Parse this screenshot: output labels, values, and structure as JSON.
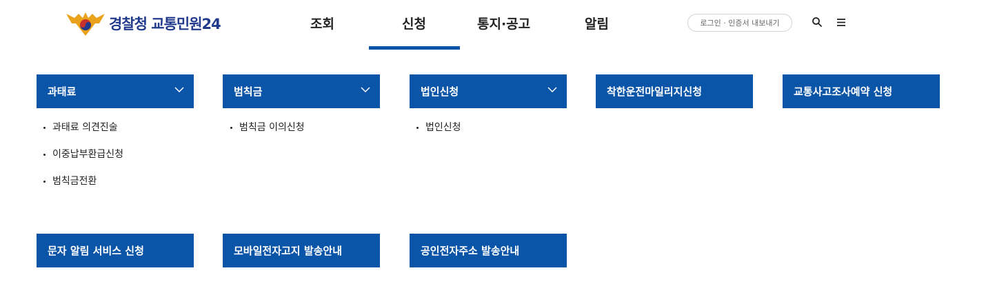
{
  "brand": {
    "name": "경찰청 교통민원24",
    "primary": "#0b55a8",
    "logo_text": "#223a8c"
  },
  "nav": {
    "items": [
      {
        "label": "조회"
      },
      {
        "label": "신청",
        "active": true
      },
      {
        "label": "통지·공고"
      },
      {
        "label": "알림"
      }
    ],
    "login": "로그인 · 인증서 내보내기",
    "icons": [
      "search-icon",
      "menu-icon"
    ]
  },
  "menu": [
    {
      "title": "과태료",
      "expandable": true,
      "items": [
        "과태료 의견진술",
        "이중납부환급신청",
        "범칙금전환"
      ]
    },
    {
      "title": "범칙금",
      "expandable": true,
      "items": [
        "범칙금 이의신청"
      ]
    },
    {
      "title": "법인신청",
      "expandable": true,
      "items": [
        "법인신청"
      ]
    },
    {
      "title": "착한운전마일리지신청",
      "expandable": false
    },
    {
      "title": "교통사고조사예약 신청",
      "expandable": false
    },
    {
      "title": "문자 알림 서비스 신청",
      "expandable": false
    },
    {
      "title": "모바일전자고지 발송안내",
      "expandable": false
    },
    {
      "title": "공인전자주소 발송안내",
      "expandable": false
    }
  ]
}
